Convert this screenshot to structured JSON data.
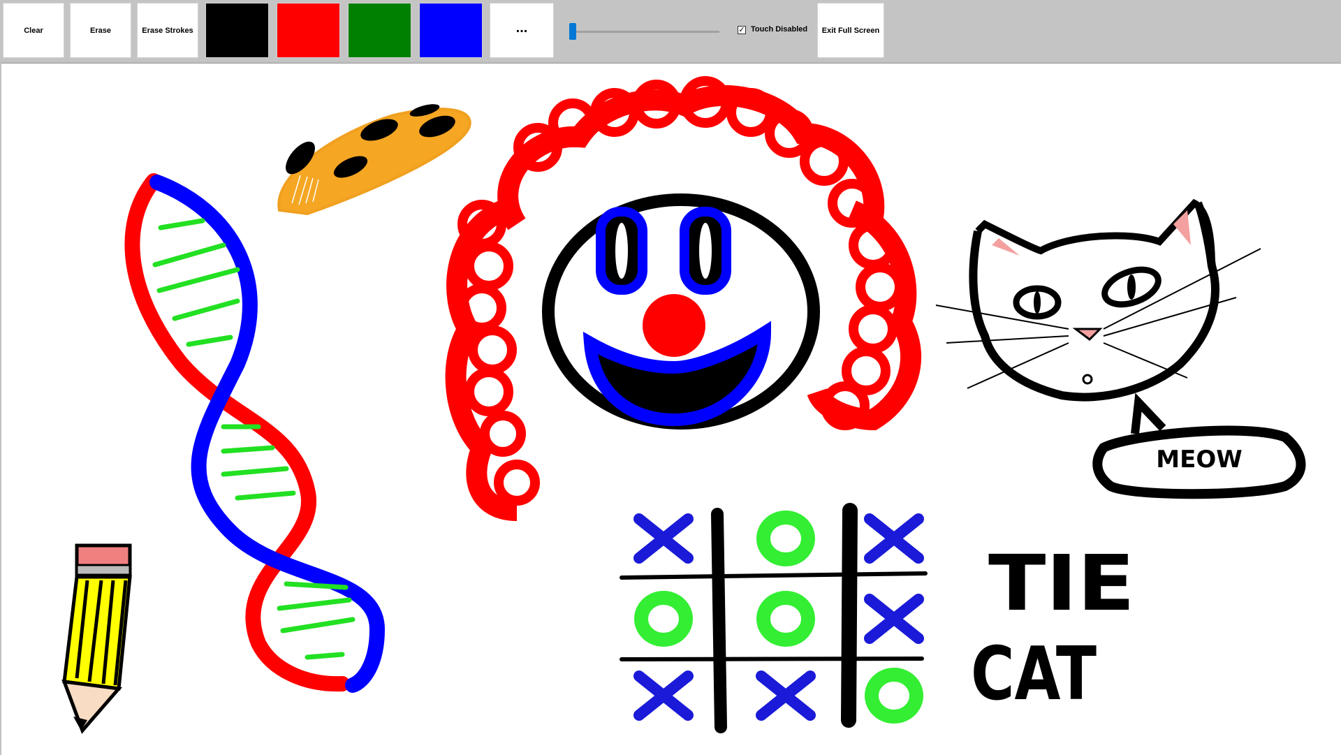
{
  "toolbar": {
    "clear_label": "Clear",
    "erase_label": "Erase",
    "erase_strokes_label": "Erase Strokes",
    "more_label": "...",
    "touch_disabled_label": "Touch Disabled",
    "touch_disabled_checked": true,
    "exit_fullscreen_label": "Exit Full Screen",
    "colors": [
      "#000000",
      "#ff0000",
      "#008000",
      "#0000ff"
    ],
    "pen_size_level": 0.02
  },
  "drawing": {
    "meow_text": "MEOW",
    "tie_text": "TIE",
    "cat_text": "CAT",
    "board": [
      "X",
      "O",
      "X",
      "O",
      "O",
      "X",
      "X",
      "X",
      "O"
    ]
  }
}
